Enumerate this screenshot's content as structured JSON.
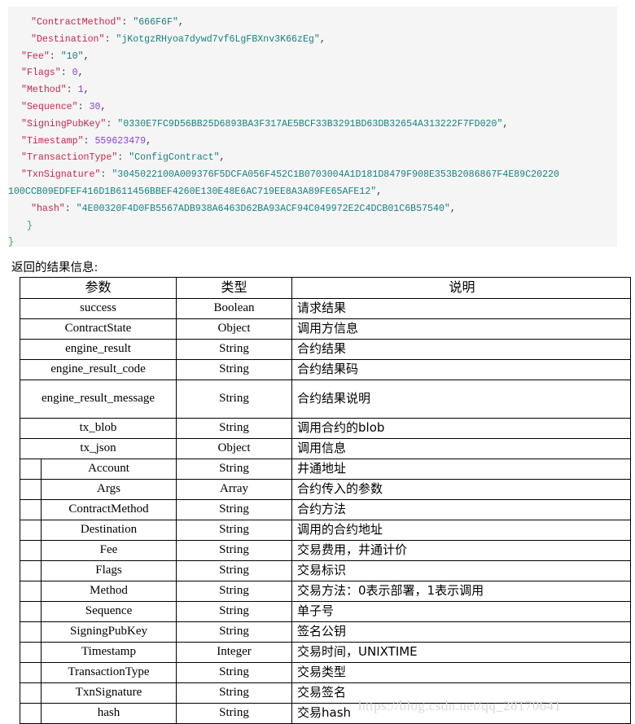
{
  "code_block": {
    "language": "json",
    "lines": [
      {
        "indent": true,
        "tokens": [
          {
            "t": "key",
            "v": "\"ContractMethod\""
          },
          {
            "t": "punct",
            "v": ": "
          },
          {
            "t": "str",
            "v": "\"666F6F\""
          },
          {
            "t": "punct",
            "v": ","
          }
        ]
      },
      {
        "indent": true,
        "tokens": [
          {
            "t": "key",
            "v": "\"Destination\""
          },
          {
            "t": "punct",
            "v": ": "
          },
          {
            "t": "str",
            "v": "\"jKotgzRHyoa7dywd7vf6LgFBXnv3K66zEg\""
          },
          {
            "t": "punct",
            "v": ","
          }
        ]
      },
      {
        "indent": false,
        "tokens": [
          {
            "t": "key",
            "v": "\"Fee\""
          },
          {
            "t": "punct",
            "v": ": "
          },
          {
            "t": "str",
            "v": "\"10\""
          },
          {
            "t": "punct",
            "v": ","
          }
        ]
      },
      {
        "indent": false,
        "tokens": [
          {
            "t": "key",
            "v": "\"Flags\""
          },
          {
            "t": "punct",
            "v": ": "
          },
          {
            "t": "num",
            "v": "0"
          },
          {
            "t": "punct",
            "v": ","
          }
        ]
      },
      {
        "indent": false,
        "tokens": [
          {
            "t": "key",
            "v": "\"Method\""
          },
          {
            "t": "punct",
            "v": ": "
          },
          {
            "t": "num",
            "v": "1"
          },
          {
            "t": "punct",
            "v": ","
          }
        ]
      },
      {
        "indent": false,
        "tokens": [
          {
            "t": "key",
            "v": "\"Sequence\""
          },
          {
            "t": "punct",
            "v": ": "
          },
          {
            "t": "num",
            "v": "30"
          },
          {
            "t": "punct",
            "v": ","
          }
        ]
      },
      {
        "indent": false,
        "tokens": [
          {
            "t": "key",
            "v": "\"SigningPubKey\""
          },
          {
            "t": "punct",
            "v": ": "
          },
          {
            "t": "str",
            "v": "\"0330E7FC9D56BB25D6893BA3F317AE5BCF33B3291BD63DB32654A313222F7FD020\""
          },
          {
            "t": "punct",
            "v": ","
          }
        ]
      },
      {
        "indent": false,
        "tokens": [
          {
            "t": "key",
            "v": "\"Timestamp\""
          },
          {
            "t": "punct",
            "v": ": "
          },
          {
            "t": "num",
            "v": "559623479"
          },
          {
            "t": "punct",
            "v": ","
          }
        ]
      },
      {
        "indent": false,
        "tokens": [
          {
            "t": "key",
            "v": "\"TransactionType\""
          },
          {
            "t": "punct",
            "v": ": "
          },
          {
            "t": "str",
            "v": "\"ConfigContract\""
          },
          {
            "t": "punct",
            "v": ","
          }
        ]
      },
      {
        "indent": false,
        "tokens": [
          {
            "t": "key",
            "v": "\"TxnSignature\""
          },
          {
            "t": "punct",
            "v": ": "
          },
          {
            "t": "str",
            "v": "\"3045022100A009376F5DCFA056F452C1B0703004A1D181D8479F908E353B2086867F4E89C20220"
          }
        ]
      },
      {
        "indent": false,
        "nopad": true,
        "tokens": [
          {
            "t": "str",
            "v": "100CCB09EDFEF416D1B611456BBEF4260E130E48E6AC719EE8A3A89FE65AFE12\""
          },
          {
            "t": "punct",
            "v": ","
          }
        ]
      },
      {
        "indent": true,
        "tokens": [
          {
            "t": "key",
            "v": "\"hash\""
          },
          {
            "t": "punct",
            "v": ": "
          },
          {
            "t": "str",
            "v": "\"4E00320F4D0FB5567ADB938A6463D62BA93ACF94C049972E2C4DCB01C6B57540\""
          },
          {
            "t": "punct",
            "v": ","
          }
        ]
      },
      {
        "indent": false,
        "tokens": [
          {
            "t": "brace",
            "v": " }"
          }
        ]
      },
      {
        "indent": false,
        "nopad": true,
        "tokens": [
          {
            "t": "brace",
            "v": "}"
          }
        ]
      }
    ],
    "colors": {
      "background": "#f5f5f5",
      "key": "#c7254e",
      "string": "#177f80",
      "number": "#8b3fd6",
      "brace": "#2fa84f",
      "punctuation": "#333333"
    }
  },
  "caption": "返回的结果信息:",
  "table": {
    "headers": [
      "参数",
      "类型",
      "说明"
    ],
    "rows": [
      {
        "indent": 0,
        "param": "success",
        "type": "Boolean",
        "desc": "请求结果"
      },
      {
        "indent": 0,
        "param": "ContractState",
        "type": "Object",
        "desc": "调用方信息"
      },
      {
        "indent": 0,
        "param": "engine_result",
        "type": "String",
        "desc": "合约结果"
      },
      {
        "indent": 0,
        "param": "engine_result_code",
        "type": "String",
        "desc": "合约结果码"
      },
      {
        "indent": 0,
        "param": "engine_result_message",
        "type": "String",
        "desc": "合约结果说明",
        "tall": true
      },
      {
        "indent": 0,
        "param": "tx_blob",
        "type": "String",
        "desc": "调用合约的blob"
      },
      {
        "indent": 0,
        "param": "tx_json",
        "type": "Object",
        "desc": "调用信息"
      },
      {
        "indent": 1,
        "param": "Account",
        "type": "String",
        "desc": "井通地址"
      },
      {
        "indent": 1,
        "param": "Args",
        "type": "Array",
        "desc": "合约传入的参数"
      },
      {
        "indent": 1,
        "param": "ContractMethod",
        "type": "String",
        "desc": "合约方法"
      },
      {
        "indent": 1,
        "param": "Destination",
        "type": "String",
        "desc": "调用的合约地址"
      },
      {
        "indent": 1,
        "param": "Fee",
        "type": "String",
        "desc": "交易费用，井通计价"
      },
      {
        "indent": 1,
        "param": "Flags",
        "type": "String",
        "desc": "交易标识"
      },
      {
        "indent": 1,
        "param": "Method",
        "type": "String",
        "desc": "交易方法：0表示部署，1表示调用"
      },
      {
        "indent": 1,
        "param": "Sequence",
        "type": "String",
        "desc": "单子号"
      },
      {
        "indent": 1,
        "param": "SigningPubKey",
        "type": "String",
        "desc": "签名公钥"
      },
      {
        "indent": 1,
        "param": "Timestamp",
        "type": "Integer",
        "desc": "交易时间，UNIXTIME"
      },
      {
        "indent": 1,
        "param": "TransactionType",
        "type": "String",
        "desc": "交易类型"
      },
      {
        "indent": 1,
        "param": "TxnSignature",
        "type": "String",
        "desc": "交易签名"
      },
      {
        "indent": 1,
        "param": "hash",
        "type": "String",
        "desc": "交易hash"
      }
    ]
  },
  "watermark": "https://blog.csdn.net/qq_28170641"
}
